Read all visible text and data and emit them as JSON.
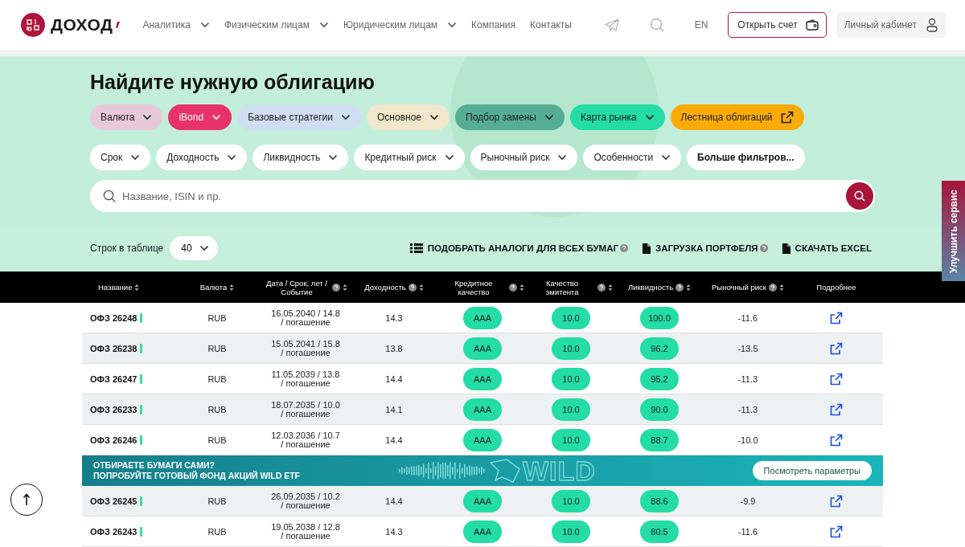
{
  "header": {
    "logo_text": "ДОХОД",
    "nav": [
      {
        "label": "Аналитика",
        "dropdown": true
      },
      {
        "label": "Физическим лицам",
        "dropdown": true
      },
      {
        "label": "Юридическим лицам",
        "dropdown": true
      },
      {
        "label": "Компания",
        "dropdown": false
      },
      {
        "label": "Контакты",
        "dropdown": false
      }
    ],
    "language": "EN",
    "open_account": "Открыть счет",
    "cabinet": "Личный кабинет"
  },
  "page_title": "Найдите нужную облигацию",
  "category_chips": [
    {
      "label": "Валюта",
      "color": "#e8c9da",
      "kind": "dropdown"
    },
    {
      "label": "iBond",
      "color": "#e7336a",
      "kind": "dropdown"
    },
    {
      "label": "Базовые стратегии",
      "color": "#cfdef0",
      "kind": "dropdown"
    },
    {
      "label": "Основное",
      "color": "#f0e7cc",
      "kind": "dropdown"
    },
    {
      "label": "Подбор замены",
      "color": "#55ae93",
      "kind": "dropdown"
    },
    {
      "label": "Карта рынка",
      "color": "#23dca6",
      "kind": "dropdown"
    },
    {
      "label": "Лестница облигаций",
      "color": "#fbab08",
      "kind": "link"
    }
  ],
  "filters": [
    {
      "label": "Срок",
      "kind": "dropdown"
    },
    {
      "label": "Доходность",
      "kind": "dropdown"
    },
    {
      "label": "Ликвидность",
      "kind": "dropdown"
    },
    {
      "label": "Кредитный риск",
      "kind": "dropdown"
    },
    {
      "label": "Рыночный риск",
      "kind": "dropdown"
    },
    {
      "label": "Особенности",
      "kind": "dropdown"
    },
    {
      "label": "Больше фильтров...",
      "kind": "more"
    }
  ],
  "search": {
    "placeholder": "Название, ISIN и пр."
  },
  "rows_per_page": {
    "label": "Строк в таблице",
    "value": "40"
  },
  "actions": [
    {
      "label": "ПОДОБРАТЬ АНАЛОГИ ДЛЯ ВСЕХ БУМАГ",
      "kind": "list",
      "help": true
    },
    {
      "label": "ЗАГРУЗКА ПОРТФЕЛЯ",
      "kind": "file",
      "help": true
    },
    {
      "label": "СКАЧАТЬ EXCEL",
      "kind": "file",
      "help": false
    }
  ],
  "table": {
    "columns": [
      {
        "label": "Название",
        "help": false,
        "sort": true
      },
      {
        "label": "Валюта",
        "help": false,
        "sort": true
      },
      {
        "label": "Дата / Срок, лет / Событие",
        "help": true,
        "sort": true
      },
      {
        "label": "Доходность",
        "help": true,
        "sort": true
      },
      {
        "label": "Кредитное качество",
        "help": true,
        "sort": true
      },
      {
        "label": "Качество эмитента",
        "help": true,
        "sort": true
      },
      {
        "label": "Ликвидность",
        "help": true,
        "sort": true
      },
      {
        "label": "Рыночный риск",
        "help": true,
        "sort": true
      },
      {
        "label": "Подробнее",
        "help": false,
        "sort": false
      }
    ],
    "rows": [
      {
        "kind": "bond",
        "name": "ОФЗ 26248",
        "currency": "RUB",
        "date": "16.05.2040 / 14.8 / погашение",
        "yield": "14.3",
        "credit": "AAA",
        "issuer": "10.0",
        "liquidity": "100.0",
        "market_risk": "-11.6"
      },
      {
        "kind": "bond",
        "name": "ОФЗ 26238",
        "currency": "RUB",
        "date": "15.05.2041 / 15.8 / погашение",
        "yield": "13.8",
        "credit": "AAA",
        "issuer": "10.0",
        "liquidity": "96.2",
        "market_risk": "-13.5"
      },
      {
        "kind": "bond",
        "name": "ОФЗ 26247",
        "currency": "RUB",
        "date": "11.05.2039 / 13.8 / погашение",
        "yield": "14.4",
        "credit": "AAA",
        "issuer": "10.0",
        "liquidity": "95.2",
        "market_risk": "-11.3"
      },
      {
        "kind": "bond",
        "name": "ОФЗ 26233",
        "currency": "RUB",
        "date": "18.07.2035 / 10.0 / погашение",
        "yield": "14.1",
        "credit": "AAA",
        "issuer": "10.0",
        "liquidity": "90.0",
        "market_risk": "-11.3"
      },
      {
        "kind": "bond",
        "name": "ОФЗ 26246",
        "currency": "RUB",
        "date": "12.03.2036 / 10.7 / погашение",
        "yield": "14.4",
        "credit": "AAA",
        "issuer": "10.0",
        "liquidity": "88.7",
        "market_risk": "-10.0"
      },
      {
        "kind": "banner",
        "lines": [
          "ОТБИРАЕТЕ БУМАГИ САМИ?",
          "ПОПРОБУЙТЕ ГОТОВЫЙ ФОНД АКЦИЙ WILD ETF"
        ],
        "logo": "WILD",
        "button": "Посмотреть параметры"
      },
      {
        "kind": "bond",
        "name": "ОФЗ 26245",
        "currency": "RUB",
        "date": "26.09.2035 / 10.2 / погашение",
        "yield": "14.4",
        "credit": "AAA",
        "issuer": "10.0",
        "liquidity": "88.6",
        "market_risk": "-9.9"
      },
      {
        "kind": "bond",
        "name": "ОФЗ 26243",
        "currency": "RUB",
        "date": "19.05.2038 / 12.8 / погашение",
        "yield": "14.3",
        "credit": "AAA",
        "issuer": "10.0",
        "liquidity": "80.5",
        "market_risk": "-11.6"
      }
    ]
  },
  "side_tab": {
    "label": "Улучшить сервис"
  }
}
